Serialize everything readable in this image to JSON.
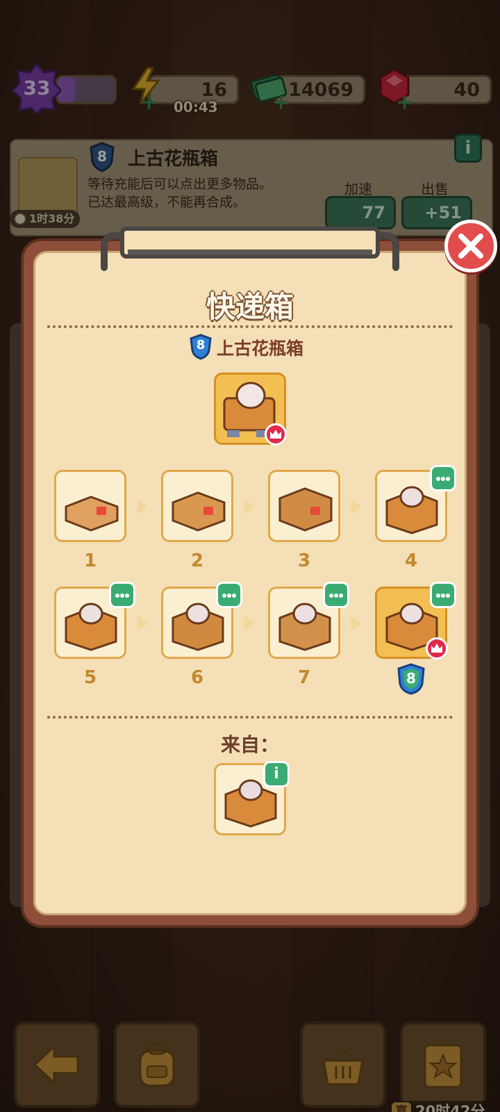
{
  "hud": {
    "level": "33",
    "xp_progress": 0.3,
    "energy": "16",
    "energy_timer": "00:43",
    "cash": "14069",
    "gems": "40"
  },
  "item_info": {
    "level": "8",
    "name": "上古花瓶箱",
    "desc_line1": "等待充能后可以点出更多物品。",
    "desc_line2": "已达最高级，不能再合成。",
    "timer": "1时38分",
    "speedup_label": "加速",
    "speedup_cost": "77",
    "sell_label": "出售",
    "sell_value": "+51",
    "info_icon": "i"
  },
  "dialog": {
    "title": "快递箱",
    "item_level": "8",
    "item_name": "上古花瓶箱",
    "chain": [
      {
        "num": "1",
        "has_more": false
      },
      {
        "num": "2",
        "has_more": false
      },
      {
        "num": "3",
        "has_more": false
      },
      {
        "num": "4",
        "has_more": true
      },
      {
        "num": "5",
        "has_more": true
      },
      {
        "num": "6",
        "has_more": true
      },
      {
        "num": "7",
        "has_more": true
      },
      {
        "num": "8",
        "has_more": true,
        "is_max": true
      }
    ],
    "max_level_badge": "8",
    "from_label": "来自：",
    "source_info_icon": "i"
  },
  "footer": {
    "event_timer": "20时42分",
    "event_icon": "喜"
  },
  "colors": {
    "panel_bg": "#f4dfb6",
    "panel_border": "#8e4f3a",
    "tile_border": "#e0a84a",
    "gold_tile": "#f3be52",
    "green_badge": "#3bab74",
    "close_red": "#e24c4c",
    "level_blue": "#2f7fd6"
  },
  "icons": [
    "close-icon",
    "level-shield-icon",
    "crown-icon",
    "more-dots-icon",
    "info-icon",
    "arrow-right-icon",
    "back-arrow-icon",
    "backpack-icon",
    "basket-icon",
    "clipboard-star-icon",
    "energy-icon",
    "cash-icon",
    "gem-icon"
  ]
}
